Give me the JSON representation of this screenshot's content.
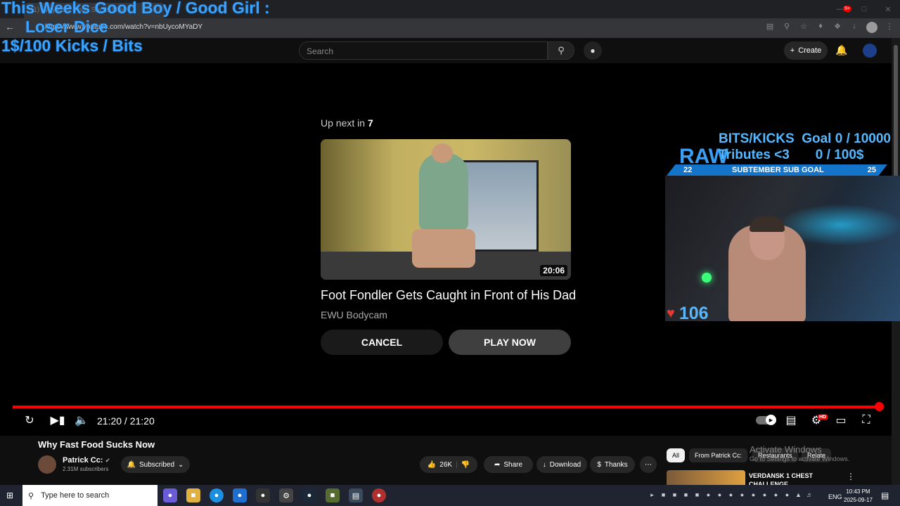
{
  "browser": {
    "tab_title": "(1) Why Fast Food Sucks Now",
    "url": "https://www.youtube.com/watch?v=nbUycoMYaDY"
  },
  "stream_overlay": {
    "line1": "This Weeks Good Boy / Good Girl :",
    "line2": "Loser Dice",
    "line3": "1$/100 Kicks / Bits"
  },
  "yt_header": {
    "search_placeholder": "Search",
    "create_label": "Create",
    "notification_count": "9+"
  },
  "up_next": {
    "label": "Up next in",
    "countdown": "7",
    "duration": "20:06",
    "title": "Foot Fondler Gets Caught in Front of His Dad",
    "channel": "EWU Bodycam",
    "cancel_label": "CANCEL",
    "play_label": "PLAY NOW"
  },
  "cam_overlay": {
    "goal1": "BITS/KICKS  Goal 0 / 10000",
    "raw": "RAW",
    "goal2": "Tributes <3       0 / 100$",
    "sub_left": "22",
    "sub_label": "SUBTEMBER SUB GOAL",
    "sub_right": "25",
    "heart_count": "106"
  },
  "player": {
    "time": "21:20 / 21:20",
    "progress_fraction": 1.0,
    "hd_badge": "HD"
  },
  "watch": {
    "title": "Why Fast Food Sucks Now",
    "channel": "Patrick Cc:",
    "subscribers": "2.31M subscribers",
    "subscribed_label": "Subscribed",
    "likes": "26K",
    "share_label": "Share",
    "download_label": "Download",
    "thanks_label": "Thanks"
  },
  "sidebar": {
    "chips": [
      "All",
      "From Patrick Cc:",
      "Restaurants",
      "Relate"
    ],
    "first_video_title": "VERDANSK 1 CHEST CHALLENGE"
  },
  "watermark": {
    "line1": "Activate Windows",
    "line2": "Go to Settings to activate Windows."
  },
  "taskbar": {
    "search_placeholder": "Type here to search",
    "language": "ENG",
    "time": "10:43 PM",
    "date": "2025-09-17"
  }
}
